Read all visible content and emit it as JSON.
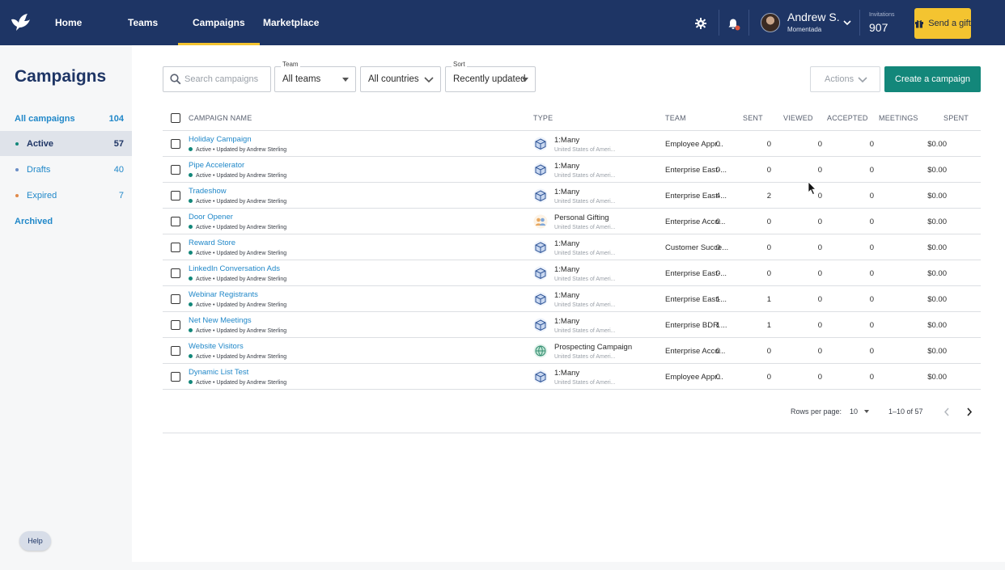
{
  "nav": {
    "items": [
      {
        "label": "Home"
      },
      {
        "label": "Teams"
      },
      {
        "label": "Campaigns"
      },
      {
        "label": "Marketplace"
      }
    ],
    "active": "Campaigns",
    "user": {
      "name": "Andrew S.",
      "org": "Momentada"
    },
    "invitations_label": "Invitations",
    "invitations_count": "907",
    "send_gift_label": "Send a gift",
    "icons": [
      "dove-logo-icon",
      "gear-icon",
      "bell-icon",
      "chevron-down-icon",
      "gift-icon"
    ]
  },
  "sidebar": {
    "title": "Campaigns",
    "items": [
      {
        "label": "All campaigns",
        "count": "104"
      },
      {
        "label": "Active",
        "count": "57",
        "dot_color": "#13877a"
      },
      {
        "label": "Drafts",
        "count": "40",
        "dot_color": "#6b8fc7"
      },
      {
        "label": "Expired",
        "count": "7",
        "dot_color": "#e08a4a"
      },
      {
        "label": "Archived",
        "count": ""
      }
    ],
    "help_label": "Help"
  },
  "toolbar": {
    "search_placeholder": "Search campaigns",
    "team_label": "Team",
    "team_value": "All teams",
    "countries_value": "All countries",
    "sort_label": "Sort",
    "sort_value": "Recently updated",
    "actions_label": "Actions",
    "create_label": "Create a campaign"
  },
  "table": {
    "columns": [
      "CAMPAIGN NAME",
      "TYPE",
      "TEAM",
      "SENT",
      "VIEWED",
      "ACCEPTED",
      "MEETINGS",
      "SPENT"
    ],
    "rows": [
      {
        "name": "Holiday Campaign",
        "status": "Active • Updated by Andrew Sterling",
        "type": "1:Many",
        "country": "United States of Ameri...",
        "team": "Employee Appr...",
        "sent": "0",
        "viewed": "0",
        "accepted": "0",
        "meetings": "0",
        "spent": "$0.00",
        "type_icon": "box-icon"
      },
      {
        "name": "Pipe Accelerator",
        "status": "Active • Updated by Andrew Sterling",
        "type": "1:Many",
        "country": "United States of Ameri...",
        "team": "Enterprise East-...",
        "sent": "0",
        "viewed": "0",
        "accepted": "0",
        "meetings": "0",
        "spent": "$0.00",
        "type_icon": "box-icon"
      },
      {
        "name": "Tradeshow",
        "status": "Active • Updated by Andrew Sterling",
        "type": "1:Many",
        "country": "United States of Ameri...",
        "team": "Enterprise East-...",
        "sent": "4",
        "viewed": "2",
        "accepted": "0",
        "meetings": "0",
        "spent": "$0.00",
        "type_icon": "box-icon"
      },
      {
        "name": "Door Opener",
        "status": "Active • Updated by Andrew Sterling",
        "type": "Personal Gifting",
        "country": "United States of Ameri...",
        "team": "Enterprise Acco...",
        "sent": "0",
        "viewed": "0",
        "accepted": "0",
        "meetings": "0",
        "spent": "$0.00",
        "type_icon": "people-icon"
      },
      {
        "name": "Reward Store",
        "status": "Active • Updated by Andrew Sterling",
        "type": "1:Many",
        "country": "United States of Ameri...",
        "team": "Customer Succe...",
        "sent": "0",
        "viewed": "0",
        "accepted": "0",
        "meetings": "0",
        "spent": "$0.00",
        "type_icon": "box-icon"
      },
      {
        "name": "LinkedIn Conversation Ads",
        "status": "Active • Updated by Andrew Sterling",
        "type": "1:Many",
        "country": "United States of Ameri...",
        "team": "Enterprise East-...",
        "sent": "0",
        "viewed": "0",
        "accepted": "0",
        "meetings": "0",
        "spent": "$0.00",
        "type_icon": "box-icon"
      },
      {
        "name": "Webinar Registrants",
        "status": "Active • Updated by Andrew Sterling",
        "type": "1:Many",
        "country": "United States of Ameri...",
        "team": "Enterprise East-...",
        "sent": "1",
        "viewed": "1",
        "accepted": "0",
        "meetings": "0",
        "spent": "$0.00",
        "type_icon": "box-icon"
      },
      {
        "name": "Net New Meetings",
        "status": "Active • Updated by Andrew Sterling",
        "type": "1:Many",
        "country": "United States of Ameri...",
        "team": "Enterprise BDR ...",
        "sent": "1",
        "viewed": "1",
        "accepted": "0",
        "meetings": "0",
        "spent": "$0.00",
        "type_icon": "box-icon"
      },
      {
        "name": "Website Visitors",
        "status": "Active • Updated by Andrew Sterling",
        "type": "Prospecting Campaign",
        "country": "United States of Ameri...",
        "team": "Enterprise Acco...",
        "sent": "0",
        "viewed": "0",
        "accepted": "0",
        "meetings": "0",
        "spent": "$0.00",
        "type_icon": "globe-icon"
      },
      {
        "name": "Dynamic List Test",
        "status": "Active • Updated by Andrew Sterling",
        "type": "1:Many",
        "country": "United States of Ameri...",
        "team": "Employee Appr...",
        "sent": "0",
        "viewed": "0",
        "accepted": "0",
        "meetings": "0",
        "spent": "$0.00",
        "type_icon": "box-icon"
      }
    ]
  },
  "pagination": {
    "rows_per_page_label": "Rows per page:",
    "rows_per_page": "10",
    "range": "1–10 of 57"
  },
  "colors": {
    "nav_bg": "#1e3565",
    "accent_yellow": "#f4c430",
    "primary_teal": "#13877a",
    "link_blue": "#2188c9"
  }
}
